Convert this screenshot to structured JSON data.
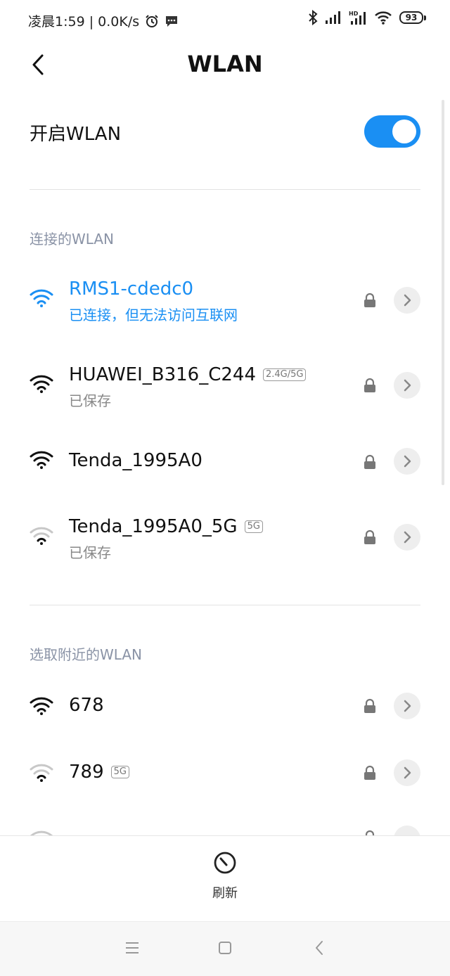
{
  "status_bar": {
    "time_text": "凌晨1:59 | 0.0K/s",
    "battery": "93",
    "icons": [
      "alarm-icon",
      "message-icon",
      "bluetooth-icon",
      "signal-icon",
      "hd-signal-icon",
      "wifi-icon"
    ]
  },
  "header": {
    "title": "WLAN"
  },
  "wlan_toggle": {
    "label": "开启WLAN",
    "on": true
  },
  "saved_section": {
    "label": "连接的WLAN"
  },
  "saved_networks": [
    {
      "name": "RMS1-cdedc0",
      "status": "已连接，但无法访问互联网",
      "band": "",
      "connected": true,
      "strength": 3
    },
    {
      "name": "HUAWEI_B316_C244",
      "status": "已保存",
      "band": "2.4G/5G",
      "connected": false,
      "strength": 3
    },
    {
      "name": "Tenda_1995A0",
      "status": "",
      "band": "",
      "connected": false,
      "strength": 3
    },
    {
      "name": "Tenda_1995A0_5G",
      "status": "已保存",
      "band": "5G",
      "connected": false,
      "strength": 1
    }
  ],
  "nearby_section": {
    "label": "选取附近的WLAN"
  },
  "nearby_networks": [
    {
      "name": "678",
      "band": "",
      "strength": 3
    },
    {
      "name": "789",
      "band": "5G",
      "strength": 1
    }
  ],
  "refresh": {
    "label": "刷新"
  },
  "colors": {
    "accent": "#1a8ff3",
    "section": "#8a93a6"
  }
}
